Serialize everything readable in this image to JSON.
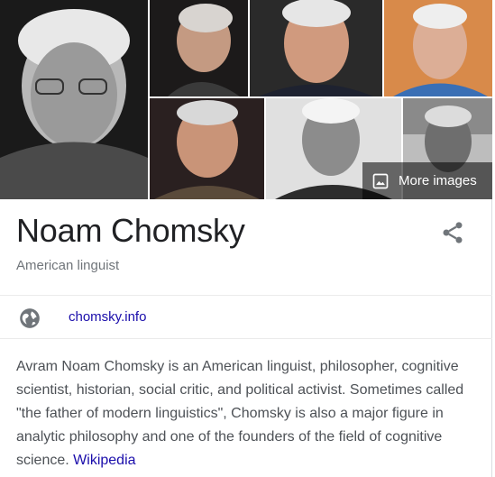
{
  "images": {
    "more_images_label": "More images"
  },
  "entity": {
    "title": "Noam Chomsky",
    "subtitle": "American linguist"
  },
  "website": {
    "label": "chomsky.info"
  },
  "description": {
    "text": "Avram Noam Chomsky is an American linguist, philosopher, cognitive scientist, historian, social critic, and political activist. Sometimes called \"the father of modern linguistics\", Chomsky is also a major figure in analytic philosophy and one of the founders of the field of cognitive science.",
    "source_link": "Wikipedia"
  },
  "colors": {
    "link": "#1a0dab",
    "title": "#202124",
    "subtitle": "#70757a",
    "body_text": "#4d5156",
    "icon_gray": "#70757a"
  },
  "icons": {
    "share": "share-icon",
    "globe": "globe-icon",
    "image": "image-icon"
  }
}
